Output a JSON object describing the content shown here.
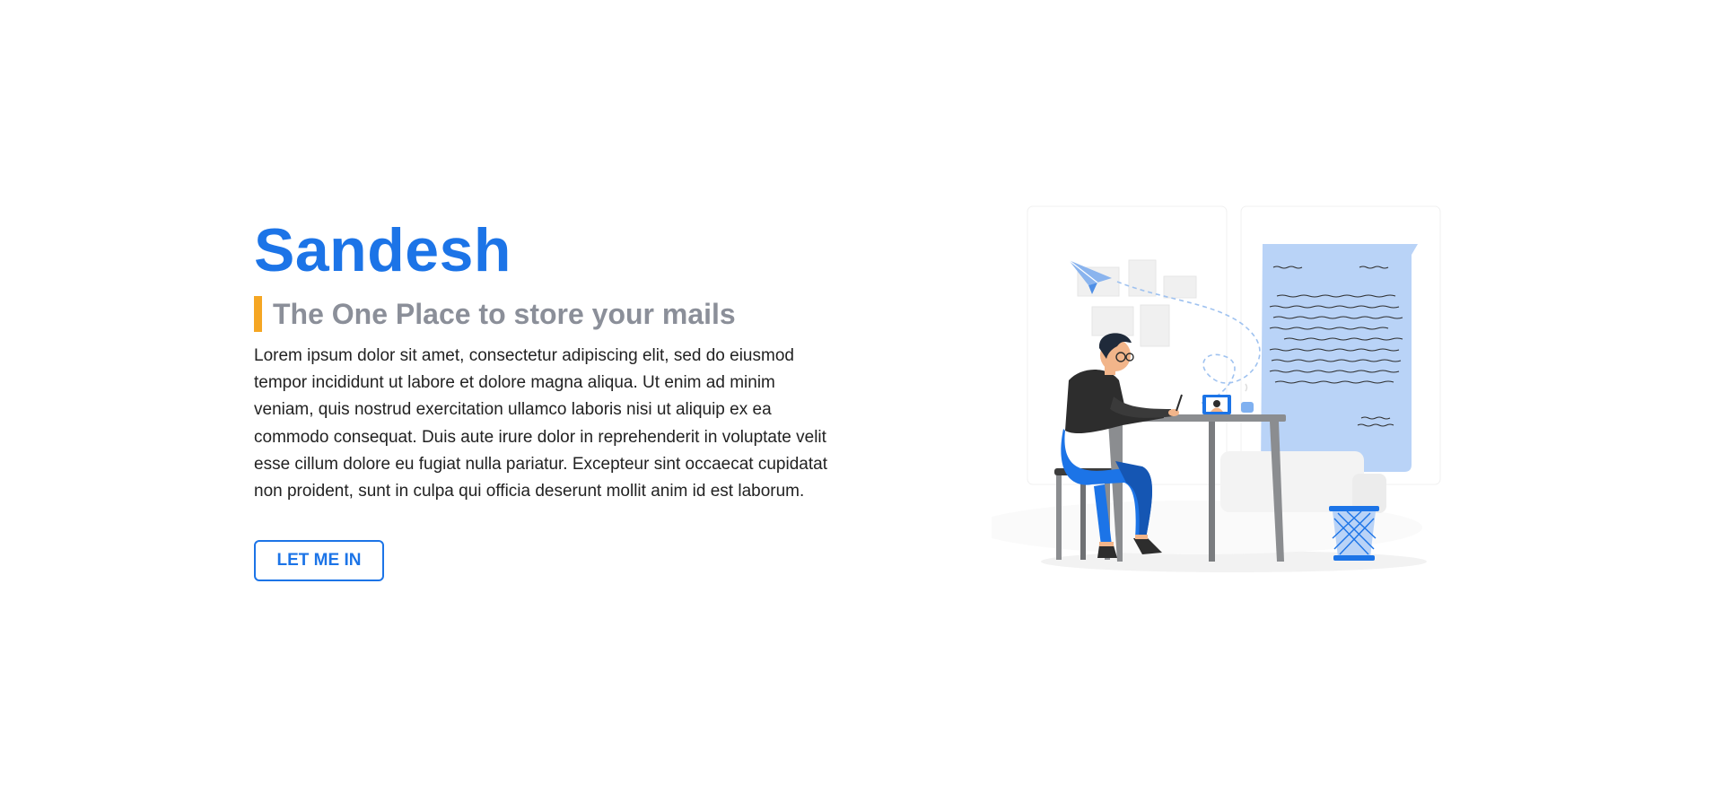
{
  "hero": {
    "brand": "Sandesh",
    "tagline": "The One Place to store your mails",
    "description": "Lorem ipsum dolor sit amet, consectetur adipiscing elit, sed do eiusmod tempor incididunt ut labore et dolore magna aliqua. Ut enim ad minim veniam, quis nostrud exercitation ullamco laboris nisi ut aliquip ex ea commodo consequat. Duis aute irure dolor in reprehenderit in voluptate velit esse cillum dolore eu fugiat nulla pariatur. Excepteur sint occaecat cupidatat non proident, sunt in culpa qui officia deserunt mollit anim id est laborum.",
    "cta_label": "LET ME IN"
  },
  "colors": {
    "brand_blue": "#1c74e7",
    "accent_orange": "#f5a623",
    "tagline_gray": "#8b8f99",
    "light_blue": "#b9d3f7"
  },
  "illustration": {
    "icon": "person-writing-letter-illustration"
  }
}
